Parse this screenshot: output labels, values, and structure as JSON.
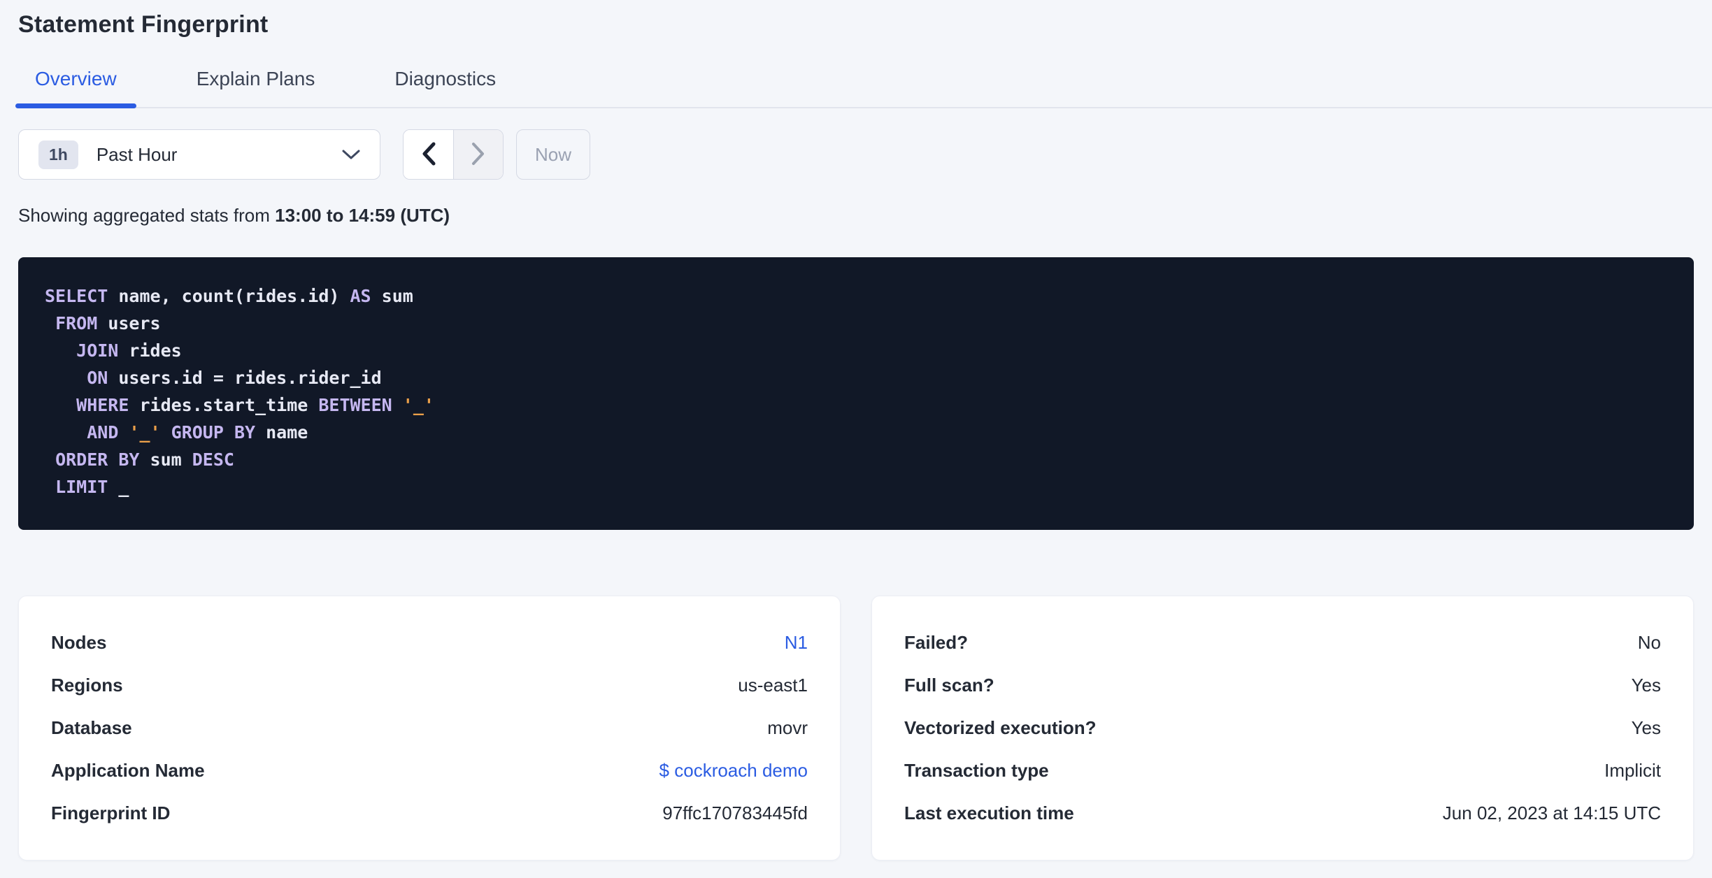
{
  "page": {
    "title": "Statement Fingerprint"
  },
  "tabs": [
    {
      "label": "Overview",
      "active": true
    },
    {
      "label": "Explain Plans",
      "active": false
    },
    {
      "label": "Diagnostics",
      "active": false
    }
  ],
  "time_controls": {
    "interval_badge": "1h",
    "interval_label": "Past Hour",
    "now_label": "Now",
    "prev_enabled": true,
    "next_enabled": false
  },
  "stats_line": {
    "prefix": "Showing aggregated stats from ",
    "range": "13:00 to 14:59 (UTC)"
  },
  "sql": {
    "lines": [
      [
        {
          "t": "k",
          "v": "SELECT"
        },
        {
          "t": "i",
          "v": " name, count(rides.id) "
        },
        {
          "t": "k",
          "v": "AS"
        },
        {
          "t": "i",
          "v": " sum"
        }
      ],
      [
        {
          "t": "i",
          "v": " "
        },
        {
          "t": "k",
          "v": "FROM"
        },
        {
          "t": "i",
          "v": " users"
        }
      ],
      [
        {
          "t": "i",
          "v": "   "
        },
        {
          "t": "k",
          "v": "JOIN"
        },
        {
          "t": "i",
          "v": " rides"
        }
      ],
      [
        {
          "t": "i",
          "v": "    "
        },
        {
          "t": "k",
          "v": "ON"
        },
        {
          "t": "i",
          "v": " users.id = rides.rider_id"
        }
      ],
      [
        {
          "t": "i",
          "v": "   "
        },
        {
          "t": "k",
          "v": "WHERE"
        },
        {
          "t": "i",
          "v": " rides.start_time "
        },
        {
          "t": "k",
          "v": "BETWEEN"
        },
        {
          "t": "i",
          "v": " "
        },
        {
          "t": "s",
          "v": "'_'"
        }
      ],
      [
        {
          "t": "i",
          "v": "    "
        },
        {
          "t": "k",
          "v": "AND"
        },
        {
          "t": "i",
          "v": " "
        },
        {
          "t": "s",
          "v": "'_'"
        },
        {
          "t": "i",
          "v": " "
        },
        {
          "t": "k",
          "v": "GROUP BY"
        },
        {
          "t": "i",
          "v": " name"
        }
      ],
      [
        {
          "t": "i",
          "v": " "
        },
        {
          "t": "k",
          "v": "ORDER BY"
        },
        {
          "t": "i",
          "v": " sum "
        },
        {
          "t": "k",
          "v": "DESC"
        }
      ],
      [
        {
          "t": "i",
          "v": " "
        },
        {
          "t": "k",
          "v": "LIMIT"
        },
        {
          "t": "i",
          "v": " _"
        }
      ]
    ]
  },
  "cards": {
    "left": {
      "rows": [
        {
          "label": "Nodes",
          "value": "N1",
          "link": true
        },
        {
          "label": "Regions",
          "value": "us-east1",
          "link": false
        },
        {
          "label": "Database",
          "value": "movr",
          "link": false
        },
        {
          "label": "Application Name",
          "value": "$ cockroach demo",
          "link": true
        },
        {
          "label": "Fingerprint ID",
          "value": "97ffc170783445fd",
          "link": false
        }
      ]
    },
    "right": {
      "rows": [
        {
          "label": "Failed?",
          "value": "No",
          "link": false
        },
        {
          "label": "Full scan?",
          "value": "Yes",
          "link": false
        },
        {
          "label": "Vectorized execution?",
          "value": "Yes",
          "link": false
        },
        {
          "label": "Transaction type",
          "value": "Implicit",
          "link": false
        },
        {
          "label": "Last execution time",
          "value": "Jun 02, 2023 at 14:15 UTC",
          "link": false
        }
      ]
    }
  },
  "colors": {
    "accent_blue": "#2b5ce2",
    "text_dark": "#242a35",
    "page_bg": "#f4f6fa",
    "code_bg": "#111827",
    "code_keyword": "#c5b7f0",
    "code_identifier": "#e7e9f4",
    "code_string": "#eba04a"
  }
}
